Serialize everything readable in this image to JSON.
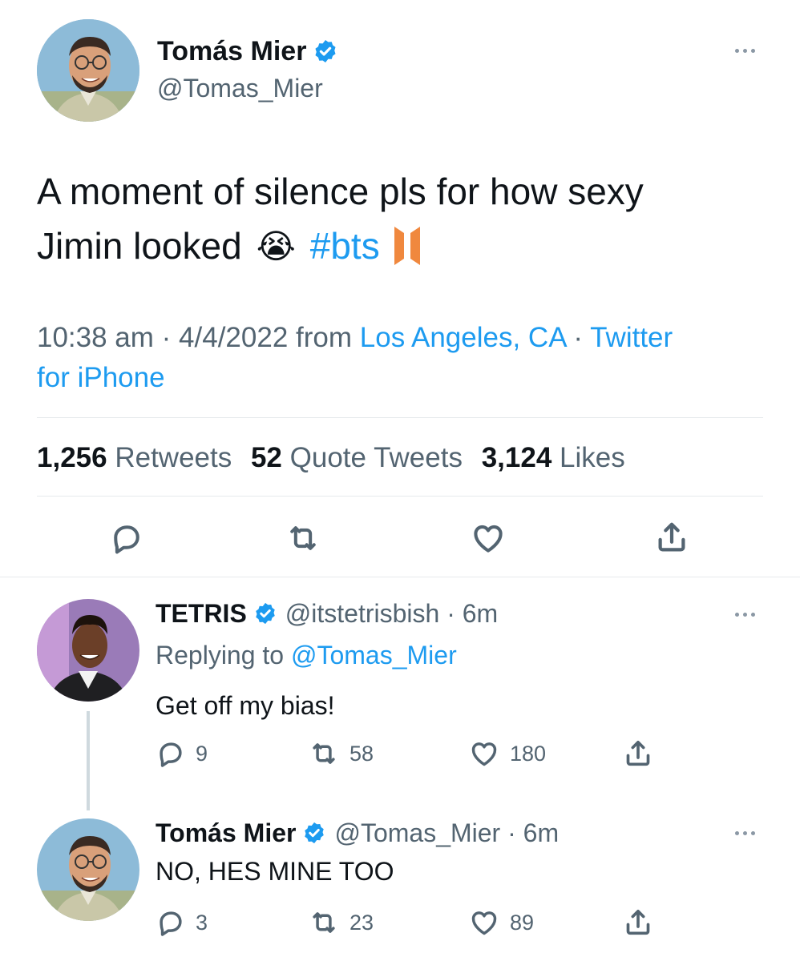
{
  "main_tweet": {
    "author_name": "Tomás Mier",
    "handle": "@Tomas_Mier",
    "text_line1": "A moment of silence pls for how sexy",
    "text_line2_prefix": "Jimin looked",
    "emoji": "😭",
    "hashtag": "#bts",
    "time": "10:38 am",
    "date": "4/4/2022",
    "from_label": "from",
    "location": "Los Angeles, CA",
    "source_line1": "Twitter",
    "source_line2": "for iPhone",
    "retweets_count": "1,256",
    "retweets_label": "Retweets",
    "quotes_count": "52",
    "quotes_label": "Quote Tweets",
    "likes_count": "3,124",
    "likes_label": "Likes"
  },
  "reply1": {
    "author_name": "TETRIS",
    "handle": "@itstetrisbish",
    "time": "6m",
    "replying_prefix": "Replying to",
    "replying_to": "@Tomas_Mier",
    "text": "Get off my bias!",
    "replies": "9",
    "retweets": "58",
    "likes": "180"
  },
  "reply2": {
    "author_name": "Tomás Mier",
    "handle": "@Tomas_Mier",
    "time": "6m",
    "text": "NO, HES MINE TOO",
    "replies": "3",
    "retweets": "23",
    "likes": "89"
  },
  "colors": {
    "link_blue": "#1d9bf0",
    "verified_blue": "#1d9bf0",
    "text_dark": "#0f1419",
    "text_grey": "#536471",
    "bts_logo_orange": "#f0883e"
  },
  "icons": [
    "verified-badge-icon",
    "more-icon",
    "reply-icon",
    "retweet-icon",
    "like-icon",
    "share-icon",
    "bts-logo-icon"
  ]
}
